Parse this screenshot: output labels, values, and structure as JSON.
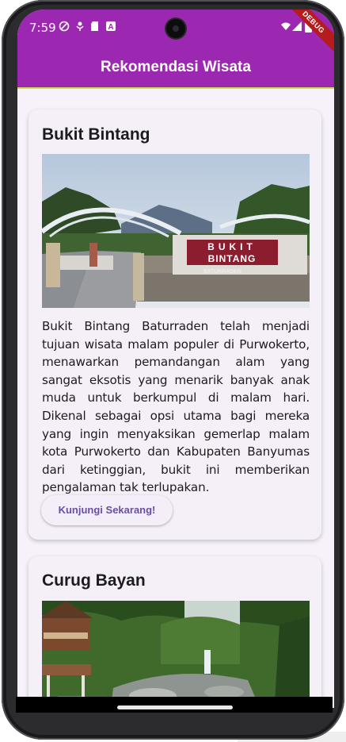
{
  "status_bar": {
    "time": "7:59",
    "left_icons": [
      "shield-icon",
      "mic-icon",
      "sd-card-icon",
      "a-badge-icon"
    ],
    "right_icons": [
      "wifi-icon",
      "signal-icon",
      "battery-icon"
    ],
    "debug_banner": "DEBUG"
  },
  "app_bar": {
    "title": "Rekomendasi Wisata",
    "color": "#9c27b0"
  },
  "destinations": [
    {
      "name": "Bukit Bintang",
      "photo_description": "Bukit Bintang Baturraden entrance sign",
      "sign_line1": "BUKIT",
      "sign_line2": "BINTANG",
      "sign_line3": "BATURRADEN",
      "description": "Bukit Bintang Baturraden telah menjadi tujuan wisata malam populer di Purwokerto, menawarkan pemandangan alam yang sangat eksotis yang menarik banyak anak muda untuk berkumpul di malam hari. Dikenal sebagai opsi utama bagi mereka yang ingin menyaksikan gemerlap malam kota Purwokerto dan Kabupaten Banyumas dari ketinggian, bukit ini memberikan pengalaman tak terlupakan.",
      "button_label": "Kunjungi Sekarang!"
    },
    {
      "name": "Curug Bayan",
      "photo_description": "Curug Bayan waterfall and forest"
    }
  ],
  "colors": {
    "accent": "#6750a4",
    "card": "#f5eff8",
    "background": "#f7f2fa"
  }
}
